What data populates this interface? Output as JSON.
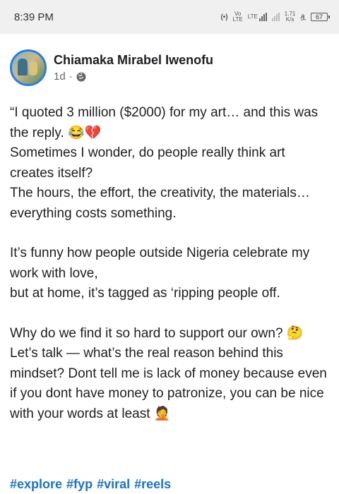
{
  "status_bar": {
    "time": "8:39 PM",
    "net_vo": "Vo",
    "net_lte": "LTE",
    "lte_label": "LTE",
    "speed_value": "1.71",
    "speed_unit": "K/s",
    "battery_level": "67"
  },
  "post": {
    "author": "Chiamaka Mirabel Iwenofu",
    "time_ago": "1d",
    "separator": "·",
    "body": {
      "p1_line1": "“I quoted 3 million ($2000) for my art… and this was the reply. 😂💔",
      "p1_line2": "Sometimes I wonder, do people really think art creates itself?",
      "p1_line3": "The hours, the effort, the creativity, the materials… everything costs something.",
      "p2_line1": "It’s funny how people outside Nigeria celebrate my work with love,",
      "p2_line2": "but at home, it’s tagged as ‘ripping people off.",
      "p3_line1": "Why do we find it so hard to support our own? 🤔",
      "p3_line2": "Let’s talk — what’s the real reason behind this mindset? Dont tell me is lack of money because even if you dont have money to patronize, you can be nice with your words at least 🤦"
    },
    "hashtags": [
      "#explore",
      "#fyp",
      "#viral",
      "#reels"
    ]
  },
  "icons": {
    "globe": "globe-icon",
    "hotspot": "hotspot-icon",
    "signal": "signal-icon",
    "battery": "battery-icon"
  },
  "colors": {
    "link": "#1a73c9",
    "avatar_ring": "#2b7de1",
    "meta": "#65676b"
  }
}
